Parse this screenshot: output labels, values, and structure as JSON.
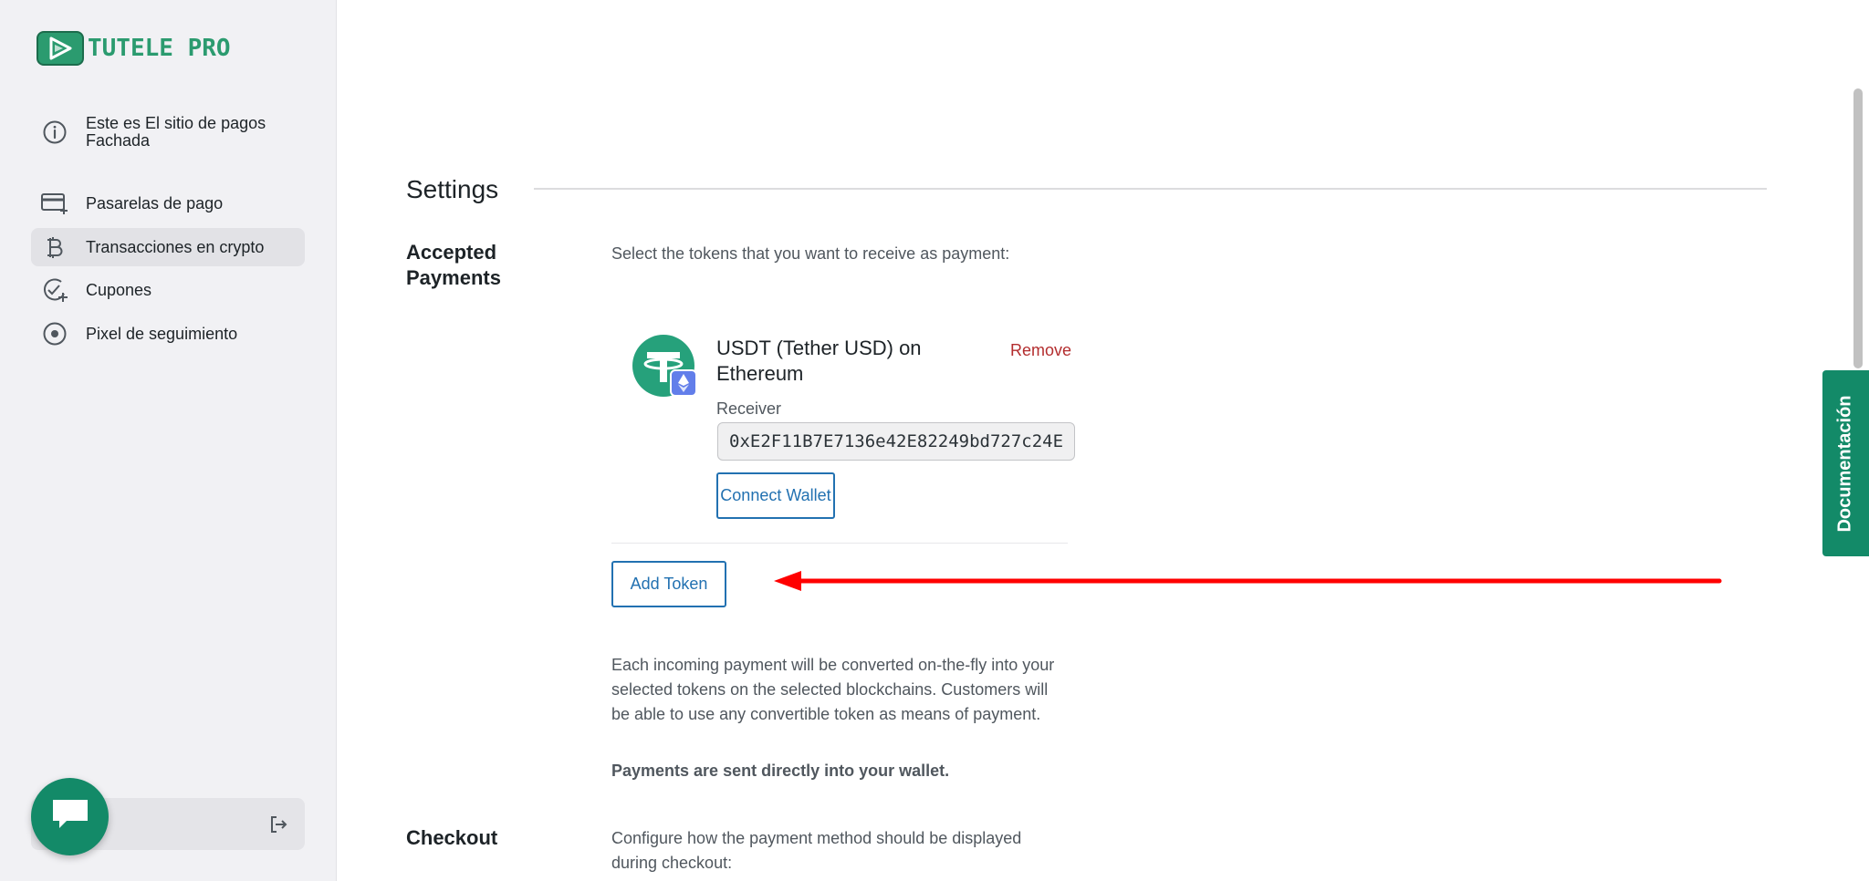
{
  "brand": {
    "name": "TUTELE PRO",
    "color": "#2b9b6f"
  },
  "sidebar": {
    "items": [
      {
        "label": "Este es El sitio de pagos Fachada",
        "icon": "info-icon"
      },
      {
        "label": "Pasarelas de pago",
        "icon": "card-plus-icon"
      },
      {
        "label": "Transacciones en crypto",
        "icon": "bitcoin-icon",
        "active": true
      },
      {
        "label": "Cupones",
        "icon": "badge-check-icon"
      },
      {
        "label": "Pixel de seguimiento",
        "icon": "target-icon"
      }
    ]
  },
  "main": {
    "title": "Settings",
    "accepted_payments": {
      "label": "Accepted Payments",
      "prompt": "Select the tokens that you want to receive as payment:",
      "token": {
        "name": "USDT (Tether USD) on Ethereum",
        "remove_label": "Remove",
        "receiver_label": "Receiver",
        "receiver_value": "0xE2F11B7E7136e42E82249bd727c24E",
        "connect_label": "Connect Wallet"
      },
      "add_token_label": "Add Token",
      "info_text": "Each incoming payment will be converted on-the-fly into your selected tokens on the selected blockchains. Customers will be able to use any convertible token as means of payment.",
      "bold_note": "Payments are sent directly into your wallet."
    },
    "checkout": {
      "label": "Checkout",
      "desc": "Configure how the payment method should be displayed during checkout:"
    }
  },
  "doc_tab": {
    "label": "Documentación"
  },
  "colors": {
    "accent_green": "#138a68",
    "link_blue": "#2271b1",
    "danger_red": "#b32d2e",
    "arrow_red": "#ff0000"
  }
}
